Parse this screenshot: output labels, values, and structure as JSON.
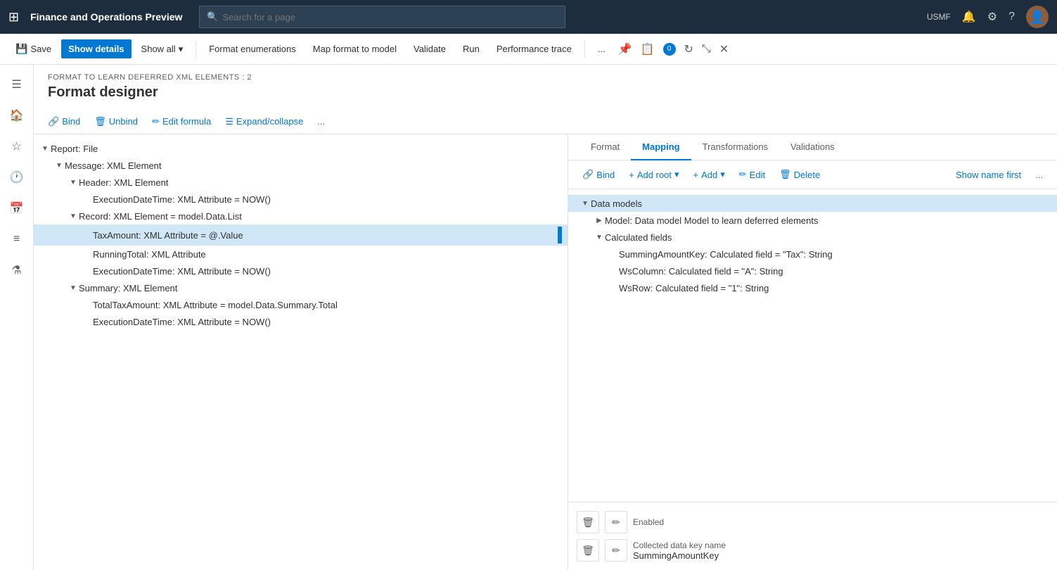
{
  "topnav": {
    "waffle": "⊞",
    "app_title": "Finance and Operations Preview",
    "search_placeholder": "Search for a page",
    "user_region": "USMF"
  },
  "toolbar": {
    "save_label": "Save",
    "show_details_label": "Show details",
    "show_all_label": "Show all",
    "format_enumerations_label": "Format enumerations",
    "map_format_to_model_label": "Map format to model",
    "validate_label": "Validate",
    "run_label": "Run",
    "performance_trace_label": "Performance trace",
    "more_label": "..."
  },
  "page": {
    "breadcrumb": "FORMAT TO LEARN DEFERRED XML ELEMENTS : 2",
    "title": "Format designer"
  },
  "format_toolbar": {
    "bind_label": "Bind",
    "unbind_label": "Unbind",
    "edit_formula_label": "Edit formula",
    "expand_collapse_label": "Expand/collapse",
    "more_label": "..."
  },
  "tree": {
    "items": [
      {
        "indent": 0,
        "toggle": "▼",
        "text": "Report: File",
        "selected": false,
        "badge": false
      },
      {
        "indent": 1,
        "toggle": "▼",
        "text": "Message: XML Element",
        "selected": false,
        "badge": false
      },
      {
        "indent": 2,
        "toggle": "▼",
        "text": "Header: XML Element",
        "selected": false,
        "badge": false
      },
      {
        "indent": 3,
        "toggle": "",
        "text": "ExecutionDateTime: XML Attribute = NOW()",
        "selected": false,
        "badge": false
      },
      {
        "indent": 2,
        "toggle": "▼",
        "text": "Record: XML Element = model.Data.List",
        "selected": false,
        "badge": false
      },
      {
        "indent": 3,
        "toggle": "",
        "text": "TaxAmount: XML Attribute = @.Value",
        "selected": true,
        "badge": true
      },
      {
        "indent": 3,
        "toggle": "",
        "text": "RunningTotal: XML Attribute",
        "selected": false,
        "badge": false
      },
      {
        "indent": 3,
        "toggle": "",
        "text": "ExecutionDateTime: XML Attribute = NOW()",
        "selected": false,
        "badge": false
      },
      {
        "indent": 2,
        "toggle": "▼",
        "text": "Summary: XML Element",
        "selected": false,
        "badge": false
      },
      {
        "indent": 3,
        "toggle": "",
        "text": "TotalTaxAmount: XML Attribute = model.Data.Summary.Total",
        "selected": false,
        "badge": false
      },
      {
        "indent": 3,
        "toggle": "",
        "text": "ExecutionDateTime: XML Attribute = NOW()",
        "selected": false,
        "badge": false
      }
    ]
  },
  "tabs": {
    "items": [
      {
        "label": "Format",
        "active": false
      },
      {
        "label": "Mapping",
        "active": true
      },
      {
        "label": "Transformations",
        "active": false
      },
      {
        "label": "Validations",
        "active": false
      }
    ]
  },
  "mapping_toolbar": {
    "bind_label": "Bind",
    "add_root_label": "Add root",
    "add_label": "Add",
    "edit_label": "Edit",
    "delete_label": "Delete",
    "show_name_first_label": "Show name first",
    "more_label": "..."
  },
  "mapping_tree": {
    "items": [
      {
        "indent": 0,
        "toggle": "▼",
        "text": "Data models",
        "selected": true
      },
      {
        "indent": 1,
        "toggle": "▶",
        "text": "Model: Data model Model to learn deferred elements",
        "selected": false
      },
      {
        "indent": 1,
        "toggle": "▼",
        "text": "Calculated fields",
        "selected": false
      },
      {
        "indent": 2,
        "toggle": "",
        "text": "SummingAmountKey: Calculated field = \"Tax\": String",
        "selected": false
      },
      {
        "indent": 2,
        "toggle": "",
        "text": "WsColumn: Calculated field = \"A\": String",
        "selected": false
      },
      {
        "indent": 2,
        "toggle": "",
        "text": "WsRow: Calculated field = \"1\": String",
        "selected": false
      }
    ]
  },
  "bottom": {
    "enabled_label": "Enabled",
    "collected_data_key_name_label": "Collected data key name",
    "collected_data_key_name_value": "SummingAmountKey"
  }
}
